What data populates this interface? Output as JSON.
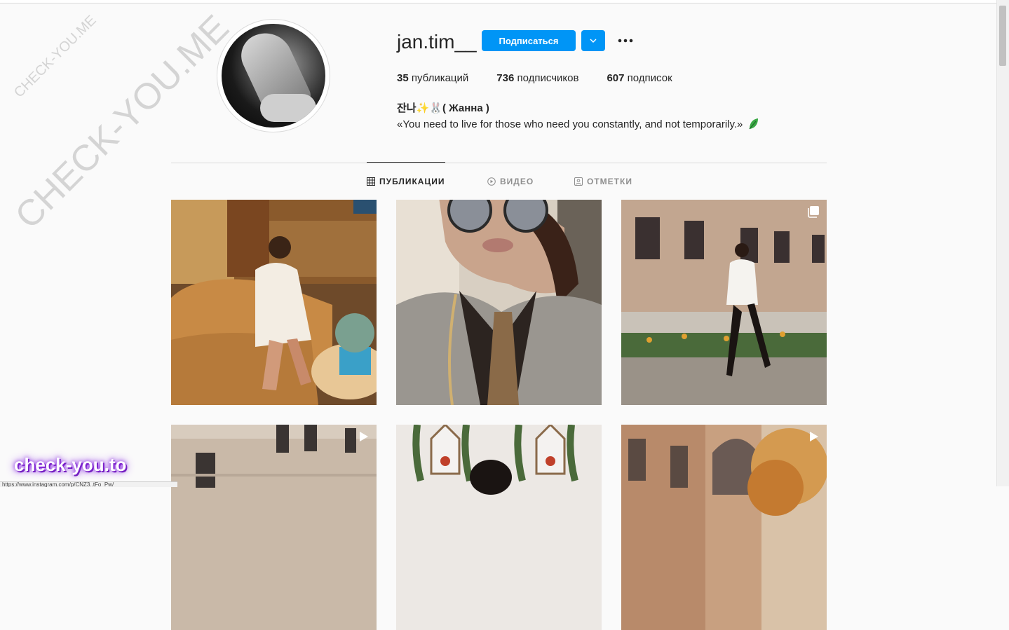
{
  "profile": {
    "username": "jan.tim__",
    "follow_label": "Подписаться",
    "posts_count": "35",
    "posts_label": "публикаций",
    "followers_count": "736",
    "followers_label": "подписчиков",
    "following_count": "607",
    "following_label": "подписок",
    "bio_name": "잔나✨🐰( Жанна )",
    "bio_text": "«You need to live for those who need you constantly, and not temporarily.»"
  },
  "tabs": [
    {
      "label": "ПУБЛИКАЦИИ",
      "icon": "grid-icon",
      "active": true
    },
    {
      "label": "ВИДЕО",
      "icon": "video-icon",
      "active": false
    },
    {
      "label": "ОТМЕТКИ",
      "icon": "tagged-icon",
      "active": false
    }
  ],
  "posts": [
    {
      "description": "woman in white lace dress on leather sofa",
      "badge": ""
    },
    {
      "description": "selfie with sunglasses and patterned scarf",
      "badge": ""
    },
    {
      "description": "woman walking in front of stone building",
      "badge": "carousel-icon"
    },
    {
      "description": "stone building facade",
      "badge": "video-icon"
    },
    {
      "description": "woman with hanging plants and house shelves",
      "badge": ""
    },
    {
      "description": "building with autumn tree",
      "badge": "video-icon"
    }
  ],
  "watermarks": {
    "large": "CHECK-YOU.ME",
    "small": "CHECK-YOU.ME",
    "bottom": "check-you.to"
  },
  "status_bar": "https://www.instagram.com/p/CNZ3..tFo_Pw/",
  "colors": {
    "accent": "#0095f6",
    "text": "#262626",
    "muted": "#8e8e8e",
    "border": "#dbdbdb",
    "background": "#fafafa"
  }
}
